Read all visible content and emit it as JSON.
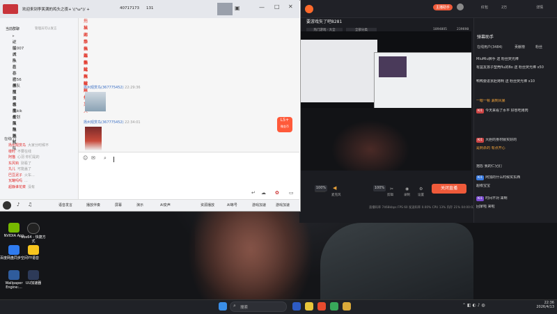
{
  "chat_app": {
    "title": "欢迎来到李笑满的鸡头之夜+ \\(°ω°)/ +",
    "group_id": "40717173",
    "member_count": "131",
    "contacts_header": "当前群聊",
    "contacts_search_placeholder": "管理员可以发言",
    "groups": [
      "逆仙城队",
      "猛犬队",
      "007",
      "小鱼",
      "盲盲",
      "小猪仔队",
      "小黑屋",
      "56城队",
      "阿猫城队",
      "黄昏全员队队",
      "东北B队",
      "周老师队队",
      "kik计划队",
      "天地城队",
      "新一代队",
      "丸儿队"
    ],
    "online_header": "在线(7)",
    "members": [
      {
        "name": "扬州观赏鸟",
        "note": "大家分时候不"
      },
      {
        "name": "楼时",
        "note": "不要在线"
      },
      {
        "name": "阿猫",
        "note": "心羽 你们是的"
      },
      {
        "name": "东风钩",
        "note": "别看了"
      },
      {
        "name": "丸儿",
        "note": "可能盖了"
      },
      {
        "name": "巴豆泥子",
        "note": "火车..."
      },
      {
        "name": "瓦罐吗吗",
        "note": "..."
      },
      {
        "name": "超静谁花菜",
        "note": "没有"
      }
    ],
    "message_lines": [
      "拖某人 — 稿阔静",
      "稿阔静 — 娜子",
      "娜子 — 东子",
      "东子 — 丸儿",
      "丸儿 — 三熊",
      "三熊 — 瓦罐",
      "瓦罐 — 鱿鱼",
      "鱿鱼 — 阿根",
      "阿根 — 拖某人"
    ],
    "sender_1": "扬州观赏鸟(367775452)",
    "time_1": "22:29:36",
    "sender_2": "扬州观赏鸟(367775452)",
    "time_2": "22:34:01",
    "sticker_label": "L5+",
    "sticker_sub": "微金币",
    "toolbar": [
      "语音发言",
      "播放伴奏",
      "屏幕",
      "演示",
      "AI变声",
      "资源播放",
      "AI等号",
      "游戏加速",
      "游戏加速"
    ],
    "bottom_tabs": [
      "语音发言",
      "播放伴奏",
      "屏幕",
      "演示",
      "AI变声"
    ]
  },
  "live": {
    "stream_title": "要游戏矢了吧8281",
    "status": "主播助手",
    "tabs": [
      "热门游戏 · 大全",
      "全部分类",
      "直播间"
    ],
    "viewer_count": "1894805",
    "likes": "239698",
    "volume_mic": "100%",
    "volume_sys": "100%",
    "labels": [
      "麦克风",
      "伴奏",
      "声卡",
      "剪辑",
      "录制",
      "设置"
    ],
    "go_live": "关闭直播",
    "stats": "直播码率 7468kbps   FPS 60   发送码率 0.00%   CPU 13%   内存 21%   04:00:02",
    "side_title": "弹幕助手",
    "side_tabs": [
      "在线用户(3484)",
      "贡献榜",
      "粉丝"
    ],
    "chat_lines": [
      "MiuMiu狮手 送 粉丝荧光棒",
      "有盆友孩子塑壳flu的Bo 送 粉丝荧光棒 x50",
      "鸭鸭要进京赶拷啊 送 粉丝荧光棒 x10",
      "一眼一顿 漏到风暴",
      "今天来看了水平 好想吃烤肉",
      "大胆的身材就实好的",
      "是刺杀的 有点开心",
      "抱怨 我的仁兄们",
      "阿加的什么时候买东西",
      "超级宝宝",
      "时间不对 来啊",
      "回家啦 来啦"
    ],
    "top_right": [
      "红包",
      "2万",
      "设置",
      "详情"
    ]
  },
  "desktop_icons": [
    "NVIDIA App",
    "obs64 - 快捷方式",
    "百度网盘同步空间",
    "YY语音",
    "Wallpaper Engine:...",
    "UU加速器"
  ],
  "taskbar": {
    "search_placeholder": "搜索",
    "clock_time": "22:36",
    "clock_date": "2026/4/13"
  }
}
